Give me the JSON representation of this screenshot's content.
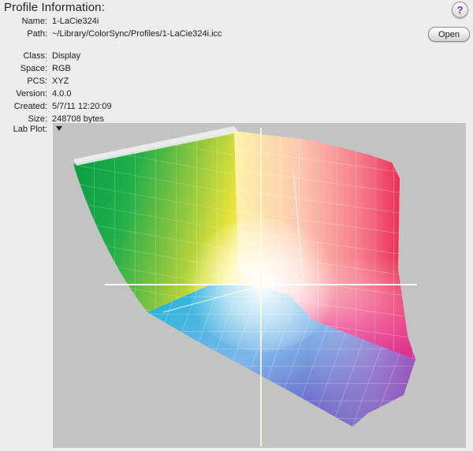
{
  "header": {
    "title": "Profile Information:",
    "help_label": "?"
  },
  "open_button": {
    "label": "Open"
  },
  "fields_top": [
    {
      "label": "Name:",
      "value": "1-LaCie324i"
    },
    {
      "label": "Path:",
      "value": "~/Library/ColorSync/Profiles/1-LaCie324i.icc"
    }
  ],
  "fields_bottom": [
    {
      "label": "Class:",
      "value": "Display"
    },
    {
      "label": "Space:",
      "value": "RGB"
    },
    {
      "label": "PCS:",
      "value": "XYZ"
    },
    {
      "label": "Version:",
      "value": "4.0.0"
    },
    {
      "label": "Created:",
      "value": "5/7/11 12:20:09"
    },
    {
      "label": "Size:",
      "value": "248708 bytes"
    }
  ],
  "plot": {
    "label": "Lab Plot:",
    "disclosure_icon": "triangle-down-icon"
  },
  "colors": {
    "window_bg": "#ededed",
    "plot_bg": "#c3c3c3",
    "help_glyph": "#6b3aa0"
  }
}
